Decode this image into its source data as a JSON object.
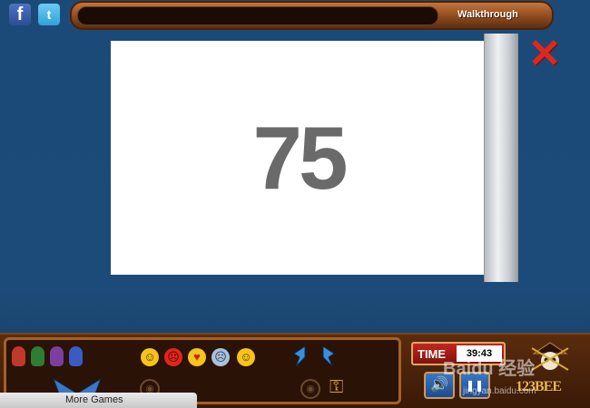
{
  "social": {
    "facebook": "f",
    "twitter": "t"
  },
  "topbar": {
    "walkthrough": "Walkthrough"
  },
  "note": {
    "number": "75"
  },
  "close": "✕",
  "inventory": {
    "dolls": [
      "#c0392b",
      "#2e7d32",
      "#7b3fa0",
      "#3b5bc2"
    ],
    "smileys": [
      {
        "icon": "happy-smiley-icon",
        "color": "#f6c21c",
        "glyph": "🙂"
      },
      {
        "icon": "angry-smiley-icon",
        "color": "#e0271d",
        "glyph": "😠"
      },
      {
        "icon": "love-smiley-icon",
        "color": "#f6c21c",
        "glyph": "😍"
      },
      {
        "icon": "sad-smiley-icon",
        "color": "#9fb9d6",
        "glyph": "🙁"
      },
      {
        "icon": "smile-smiley-icon",
        "color": "#f6c21c",
        "glyph": "🙂"
      }
    ]
  },
  "more_games": "More Games",
  "time": {
    "label": "TIME",
    "value": "39:43"
  },
  "controls": {
    "sound": "🔊",
    "pause": "❚❚"
  },
  "logo": {
    "text": "123BEE"
  },
  "watermark": {
    "main": "Baidu 经验",
    "sub": "jingyan.baidu.com"
  }
}
